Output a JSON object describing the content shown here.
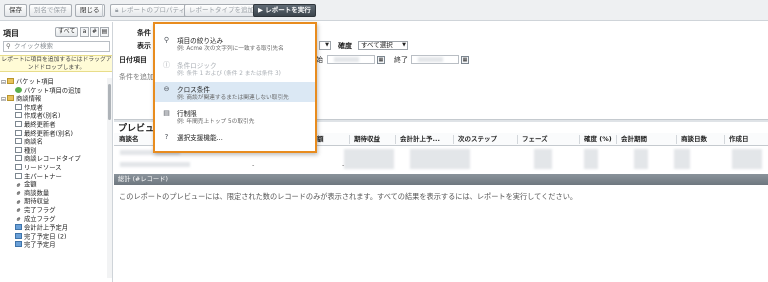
{
  "toolbar": {
    "save": "保存",
    "save_as": "別名で保存",
    "close": "閉じる",
    "report_props": "レポートのプロパティ",
    "add_report_type": "レポートタイプを追加",
    "run_report": "レポートを実行"
  },
  "left": {
    "title": "項目",
    "filter_label": "すべて",
    "search_placeholder": "クイック検索",
    "hint": "レポートに項目を追加するにはドラッグアンドドロップします。",
    "tree": [
      {
        "label": "バケット項目",
        "icon": "folder-icon",
        "indent": 0,
        "toggle": "⊟"
      },
      {
        "label": "バケット項目の追加",
        "icon": "add-icon",
        "indent": 2,
        "toggle": ""
      },
      {
        "label": "商談情報",
        "icon": "folder-icon",
        "indent": 0,
        "toggle": "⊟"
      },
      {
        "label": "作成者",
        "icon": "field-icon",
        "indent": 2,
        "toggle": ""
      },
      {
        "label": "作成者(別名)",
        "icon": "field-icon",
        "indent": 2,
        "toggle": ""
      },
      {
        "label": "最終更新者",
        "icon": "field-icon",
        "indent": 2,
        "toggle": ""
      },
      {
        "label": "最終更新者(別名)",
        "icon": "field-icon",
        "indent": 2,
        "toggle": ""
      },
      {
        "label": "商談名",
        "icon": "field-icon",
        "indent": 2,
        "toggle": ""
      },
      {
        "label": "種別",
        "icon": "field-icon",
        "indent": 2,
        "toggle": ""
      },
      {
        "label": "商談レコードタイプ",
        "icon": "field-icon",
        "indent": 2,
        "toggle": ""
      },
      {
        "label": "リードソース",
        "icon": "field-icon",
        "indent": 2,
        "toggle": ""
      },
      {
        "label": "主パートナー",
        "icon": "field-icon",
        "indent": 2,
        "toggle": ""
      },
      {
        "label": "金額",
        "icon": "number-icon",
        "indent": 2,
        "toggle": ""
      },
      {
        "label": "商談数量",
        "icon": "number-icon",
        "indent": 2,
        "toggle": ""
      },
      {
        "label": "期待収益",
        "icon": "number-icon",
        "indent": 2,
        "toggle": ""
      },
      {
        "label": "完了フラグ",
        "icon": "number-icon",
        "indent": 2,
        "toggle": ""
      },
      {
        "label": "成立フラグ",
        "icon": "number-icon",
        "indent": 2,
        "toggle": ""
      },
      {
        "label": "会計計上予定月",
        "icon": "date-icon",
        "indent": 2,
        "toggle": ""
      },
      {
        "label": "完了予定日 (2)",
        "icon": "date-icon",
        "indent": 2,
        "toggle": ""
      },
      {
        "label": "完了予定月",
        "icon": "date-icon",
        "indent": 2,
        "toggle": ""
      }
    ]
  },
  "filters": {
    "conditions_label": "条件",
    "add_label": "追加",
    "show_label": "表示",
    "date_field_label": "日付項目",
    "start_label": "始",
    "end_label": "終了",
    "probability_label": "確度",
    "probability_value": "すべて選択",
    "no_conditions": "条件を追加"
  },
  "dropdown": {
    "items": [
      {
        "title": "項目の絞り込み",
        "sub": "例: Acme 次の文字列に一致する取引先名",
        "icon": "filter-icon",
        "disabled": false,
        "highlight": false
      },
      {
        "title": "条件ロジック",
        "sub": "例: 条件 1 および (条件 2 または条件 3)",
        "icon": "logic-icon",
        "disabled": true,
        "highlight": false
      },
      {
        "title": "クロス条件",
        "sub": "例: 商談が関連するまたは関連しない取引先",
        "icon": "cross-filter-icon",
        "disabled": false,
        "highlight": true
      },
      {
        "title": "行制限",
        "sub": "例: 年間売上トップ 5の取引先",
        "icon": "row-limit-icon",
        "disabled": false,
        "highlight": false
      },
      {
        "title": "選択支援機能...",
        "sub": "",
        "icon": "help-icon",
        "disabled": false,
        "highlight": false
      }
    ]
  },
  "preview": {
    "title": "プレビュー",
    "columns": [
      "商談名",
      "額",
      "期待収益",
      "会計計上予...",
      "次のステップ",
      "フェーズ",
      "確度 (%)",
      "会計期間",
      "商談日数",
      "作成日"
    ],
    "summary_label": "総計 (#レコード)",
    "note": "このレポートのプレビューには、限定された数のレコードのみが表示されます。すべての結果を表示するには、レポートを実行してください。",
    "dash": "-"
  }
}
